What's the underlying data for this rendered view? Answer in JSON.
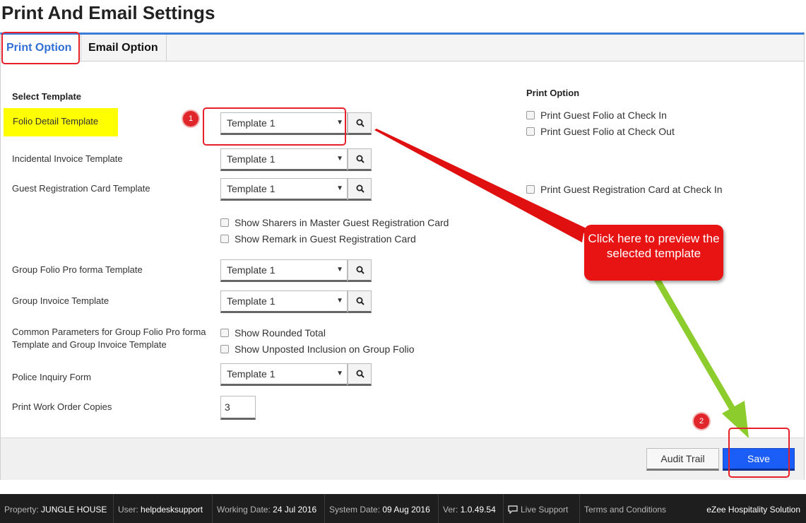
{
  "page": {
    "title": "Print And Email Settings"
  },
  "tabs": [
    {
      "label": "Print Option"
    },
    {
      "label": "Email Option"
    }
  ],
  "left": {
    "section_title": "Select Template",
    "fields": [
      {
        "label": "Folio Detail Template",
        "value": "Template 1"
      },
      {
        "label": "Incidental Invoice Template",
        "value": "Template 1"
      },
      {
        "label": "Guest Registration Card Template",
        "value": "Template 1"
      },
      {
        "label": "Group Folio Pro forma Template",
        "value": "Template 1"
      },
      {
        "label": "Group Invoice Template",
        "value": "Template 1"
      },
      {
        "label": "Police Inquiry Form",
        "value": "Template 1"
      }
    ],
    "guest_card_options": [
      "Show Sharers in Master Guest Registration Card",
      "Show Remark in Guest Registration Card"
    ],
    "common_params_label": "Common Parameters for Group Folio Pro forma Template and Group Invoice Template",
    "common_params_options": [
      "Show Rounded Total",
      "Show Unposted Inclusion on Group Folio"
    ],
    "work_order_label": "Print Work Order Copies",
    "work_order_value": "3"
  },
  "right": {
    "section_title": "Print Option",
    "options": [
      "Print Guest Folio at Check In",
      "Print Guest Folio at Check Out",
      "Print Guest Registration Card at Check In"
    ]
  },
  "buttons": {
    "audit_trail": "Audit Trail",
    "save": "Save"
  },
  "annotations": {
    "badge_1": "1",
    "badge_2": "2",
    "callout": "Click here to preview the selected template",
    "colors": {
      "box": "#e8202a",
      "callout": "#e81313",
      "green_arrow": "#8ccc2c"
    }
  },
  "status_bar": {
    "property_label": "Property:",
    "property_value": "JUNGLE HOUSE",
    "user_label": "User:",
    "user_value": "helpdesksupport",
    "working_date_label": "Working Date:",
    "working_date_value": "24 Jul 2016",
    "system_date_label": "System Date:",
    "system_date_value": "09 Aug 2016",
    "version_label": "Ver:",
    "version_value": "1.0.49.54",
    "live_support": "Live Support",
    "terms": "Terms and Conditions",
    "brand": "eZee Hospitality Solution"
  }
}
